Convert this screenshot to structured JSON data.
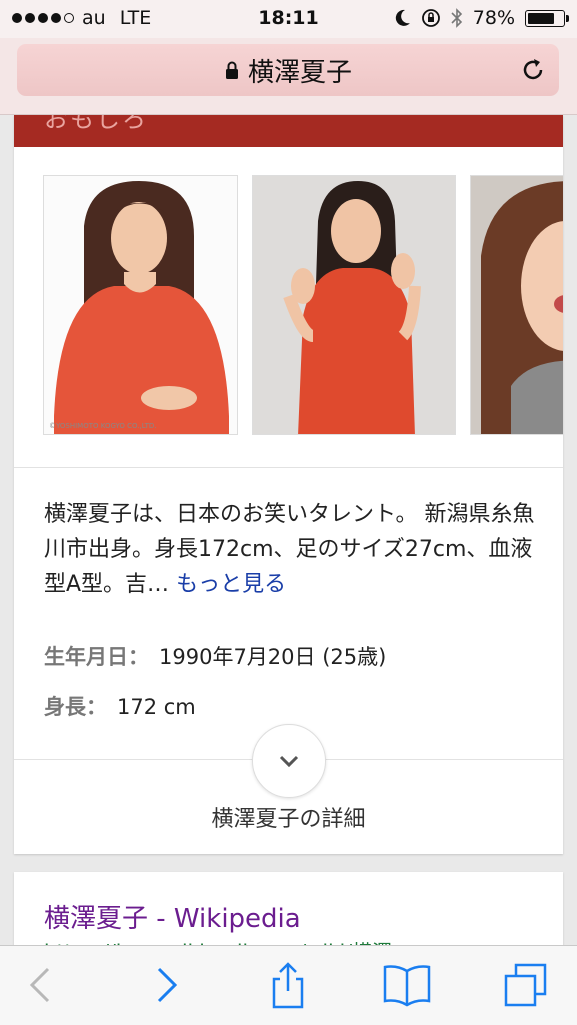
{
  "status_bar": {
    "carrier": "au",
    "network": "LTE",
    "time": "18:11",
    "battery": "78%",
    "battery_level": 0.78,
    "signal_bars": 4
  },
  "browser": {
    "page_title": "横澤夏子",
    "accent_color": "#1a7ef0"
  },
  "knowledge_card": {
    "header_text": "おもしろ",
    "header_color": "#a52a22",
    "description": "横澤夏子は、日本のお笑いタレント。 新潟県糸魚川市出身。身長172cm、足のサイズ27cm、血液型A型。吉…",
    "more_link": "もっと見る",
    "facts": [
      {
        "label": "生年月日：",
        "value": "1990年7月20日 (25歳)"
      },
      {
        "label": "身長：",
        "value": "172 cm"
      }
    ],
    "photo_caption": "©YOSHIMOTO KOGYO CO.,LTD.",
    "details_label": "横澤夏子の詳細"
  },
  "result": {
    "title": "横澤夏子 - Wikipedia",
    "url": "https://ja.m.wikipedia.org/wiki/横澤"
  }
}
